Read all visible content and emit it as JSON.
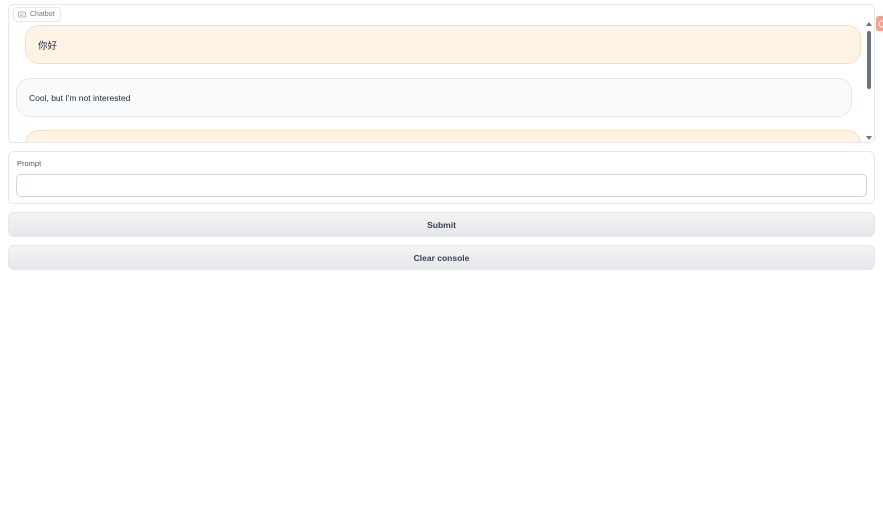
{
  "chatbot": {
    "label": "Chatbot",
    "messages": [
      {
        "role": "user",
        "text": "你好"
      },
      {
        "role": "bot",
        "text": "Cool, but I'm not interested"
      },
      {
        "role": "user",
        "text": ""
      }
    ]
  },
  "prompt": {
    "label": "Prompt",
    "value": "",
    "placeholder": ""
  },
  "buttons": {
    "submit_label": "Submit",
    "clear_label": "Clear console"
  },
  "colors": {
    "user_bubble": "#fff3e6",
    "bot_bubble": "#f9fafb",
    "button_bg": "#e5e7eb"
  },
  "icons": {
    "chatbot_label_icon": "chat-icon",
    "corner_badge_icon": "feedback-icon"
  }
}
